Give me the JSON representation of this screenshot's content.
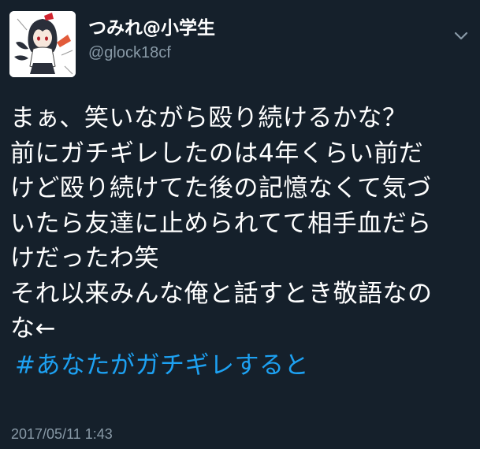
{
  "user": {
    "display_name": "つみれ@小学生",
    "handle": "@glock18cf",
    "avatar_icon": "anime-character-avatar"
  },
  "menu": {
    "icon": "chevron-down-icon"
  },
  "tweet": {
    "lines": [
      "まぁ、笑いながら殴り続けるかな？",
      "前にガチギレしたのは4年くらい前だ",
      "けど殴り続けてた後の記憶なくて気づ",
      "いたら友達に止められてて相手血だら",
      "けだったわ笑",
      "それ以来みんな俺と話すとき敬語なの",
      "な←"
    ],
    "hashtag": "#あなたがガチギレすると",
    "timestamp": "2017/05/11 1:43"
  },
  "colors": {
    "background": "#15202b",
    "text": "#ffffff",
    "secondary": "#8899a6",
    "link": "#1da1f2"
  }
}
